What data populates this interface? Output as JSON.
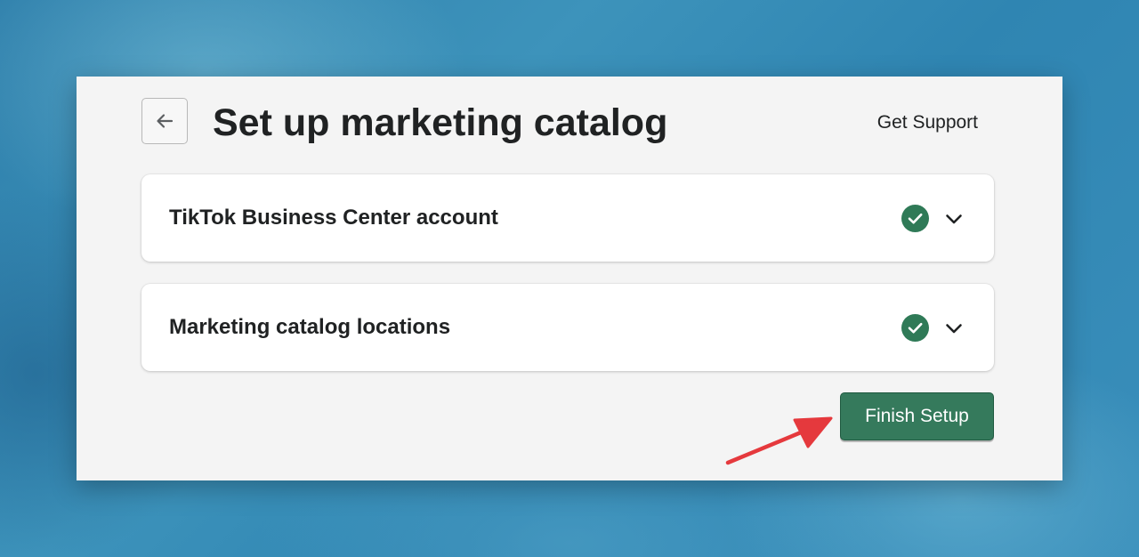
{
  "header": {
    "back_icon": "arrow-left-icon",
    "title": "Set up marketing catalog",
    "support_label": "Get Support"
  },
  "steps": [
    {
      "label": "TikTok Business Center account",
      "status": "complete",
      "status_icon": "checkmark-circle-icon",
      "toggle_icon": "chevron-down-icon"
    },
    {
      "label": "Marketing catalog locations",
      "status": "complete",
      "status_icon": "checkmark-circle-icon",
      "toggle_icon": "chevron-down-icon"
    }
  ],
  "actions": {
    "finish_label": "Finish Setup"
  },
  "colors": {
    "accent_green": "#357a5c",
    "check_green": "#2f7a57",
    "annotation_red": "#e5393d",
    "panel_bg": "#f4f4f4",
    "text": "#202223"
  }
}
